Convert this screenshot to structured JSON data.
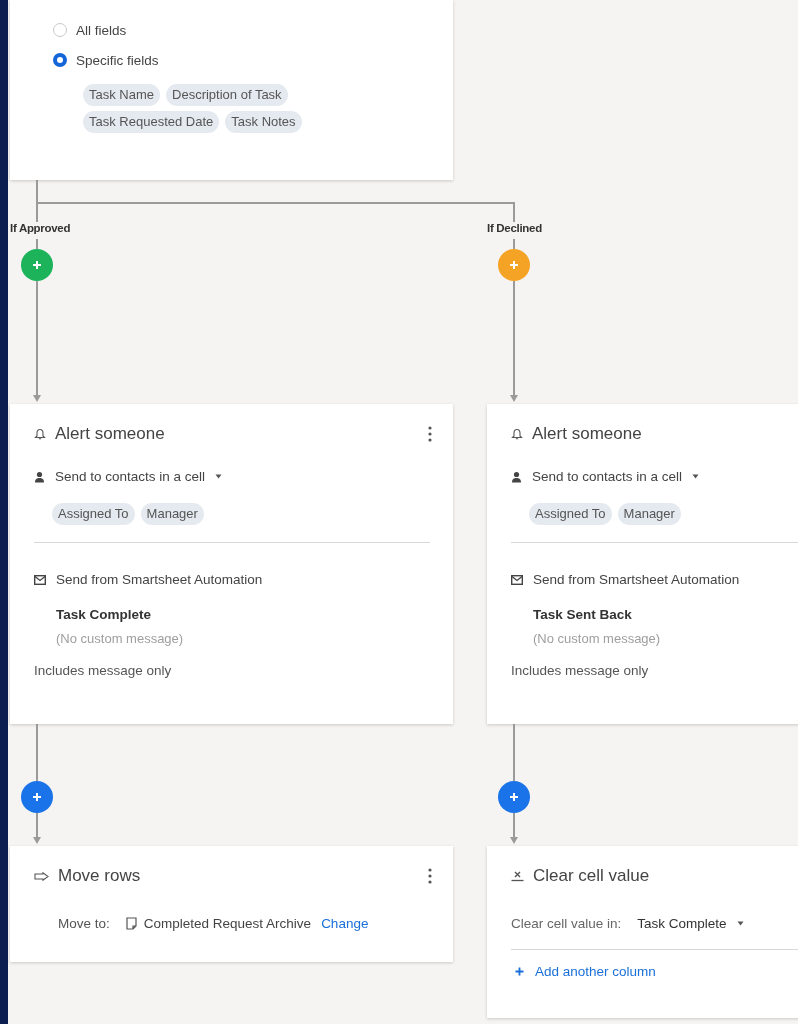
{
  "fields_card": {
    "options": [
      {
        "label": "All fields",
        "selected": false
      },
      {
        "label": "Specific fields",
        "selected": true
      }
    ],
    "chips": [
      "Task Name",
      "Description of Task",
      "Task Requested Date",
      "Task Notes"
    ]
  },
  "branches": [
    {
      "label": "If Approved",
      "color": "#1db35a",
      "alert": {
        "title": "Alert someone",
        "has_menu": true,
        "recipients_mode": "Send to contacts in a cell",
        "recipients": [
          "Assigned To",
          "Manager"
        ],
        "sender": "Send from Smartsheet Automation",
        "subject": "Task Complete",
        "message_note": "(No custom message)",
        "includes": "Includes message only"
      },
      "action": {
        "kind": "move",
        "title": "Move rows",
        "has_menu": true,
        "label": "Move to:",
        "target": "Completed Request Archive",
        "link": "Change"
      }
    },
    {
      "label": "If Declined",
      "color": "#f5a325",
      "alert": {
        "title": "Alert someone",
        "recipients_mode": "Send to contacts in a cell",
        "recipients": [
          "Assigned To",
          "Manager"
        ],
        "sender": "Send from Smartsheet Automation",
        "subject": "Task Sent Back",
        "message_note": "(No custom message)",
        "includes": "Includes message only"
      },
      "action": {
        "kind": "clear",
        "title": "Clear cell value",
        "label": "Clear cell value in:",
        "value": "Task Complete",
        "link": "Add another column"
      }
    }
  ]
}
